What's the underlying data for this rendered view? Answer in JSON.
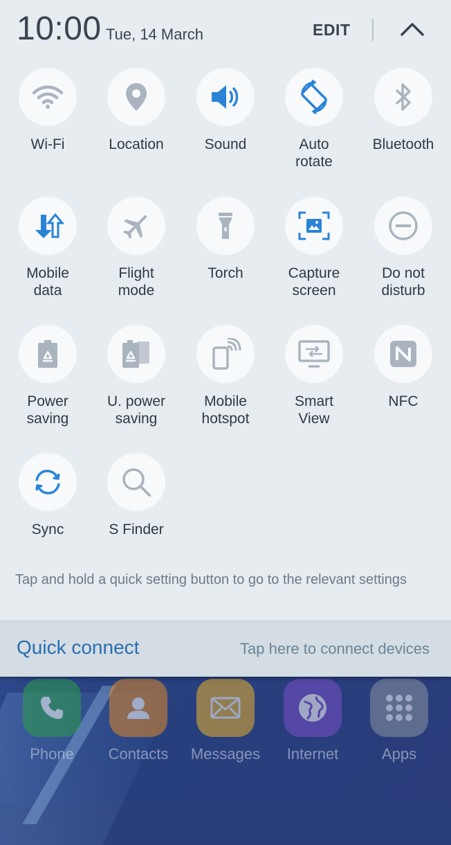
{
  "status": {
    "time": "10:00",
    "date": "Tue, 14 March"
  },
  "header": {
    "edit_label": "EDIT",
    "collapse_icon": "chevron-up-icon"
  },
  "tiles": [
    {
      "label": "Wi-Fi",
      "icon": "wifi-icon",
      "active": false
    },
    {
      "label": "Location",
      "icon": "location-pin-icon",
      "active": false
    },
    {
      "label": "Sound",
      "icon": "speaker-icon",
      "active": true
    },
    {
      "label": "Auto\nrotate",
      "icon": "auto-rotate-icon",
      "active": true
    },
    {
      "label": "Bluetooth",
      "icon": "bluetooth-icon",
      "active": false
    },
    {
      "label": "Mobile\ndata",
      "icon": "mobile-data-icon",
      "active": true
    },
    {
      "label": "Flight\nmode",
      "icon": "airplane-icon",
      "active": false
    },
    {
      "label": "Torch",
      "icon": "torch-icon",
      "active": false
    },
    {
      "label": "Capture\nscreen",
      "icon": "capture-screen-icon",
      "active": true
    },
    {
      "label": "Do not\ndisturb",
      "icon": "do-not-disturb-icon",
      "active": false
    },
    {
      "label": "Power\nsaving",
      "icon": "battery-recycle-icon",
      "active": false
    },
    {
      "label": "U. power\nsaving",
      "icon": "ultra-power-saving-icon",
      "active": false
    },
    {
      "label": "Mobile\nhotspot",
      "icon": "hotspot-icon",
      "active": false
    },
    {
      "label": "Smart\nView",
      "icon": "smart-view-icon",
      "active": false
    },
    {
      "label": "NFC",
      "icon": "nfc-icon",
      "active": false
    },
    {
      "label": "Sync",
      "icon": "sync-icon",
      "active": true
    },
    {
      "label": "S Finder",
      "icon": "search-icon",
      "active": false
    }
  ],
  "hint": "Tap and hold a quick setting button to go to the relevant settings",
  "quick_connect": {
    "title": "Quick connect",
    "hint": "Tap here to connect devices"
  },
  "dock": [
    {
      "label": "Phone",
      "icon": "phone-icon",
      "color": "#2e9e4a"
    },
    {
      "label": "Contacts",
      "icon": "contacts-icon",
      "color": "#e08a2a"
    },
    {
      "label": "Messages",
      "icon": "messages-icon",
      "color": "#e8b02a"
    },
    {
      "label": "Internet",
      "icon": "globe-icon",
      "color": "#7a4fc8"
    },
    {
      "label": "Apps",
      "icon": "apps-grid-icon",
      "color": "#8a93a0"
    }
  ],
  "colors": {
    "accent": "#2a84d6",
    "inactive_icon": "#aab4bf",
    "panel_bg": "#e7ecf0"
  }
}
